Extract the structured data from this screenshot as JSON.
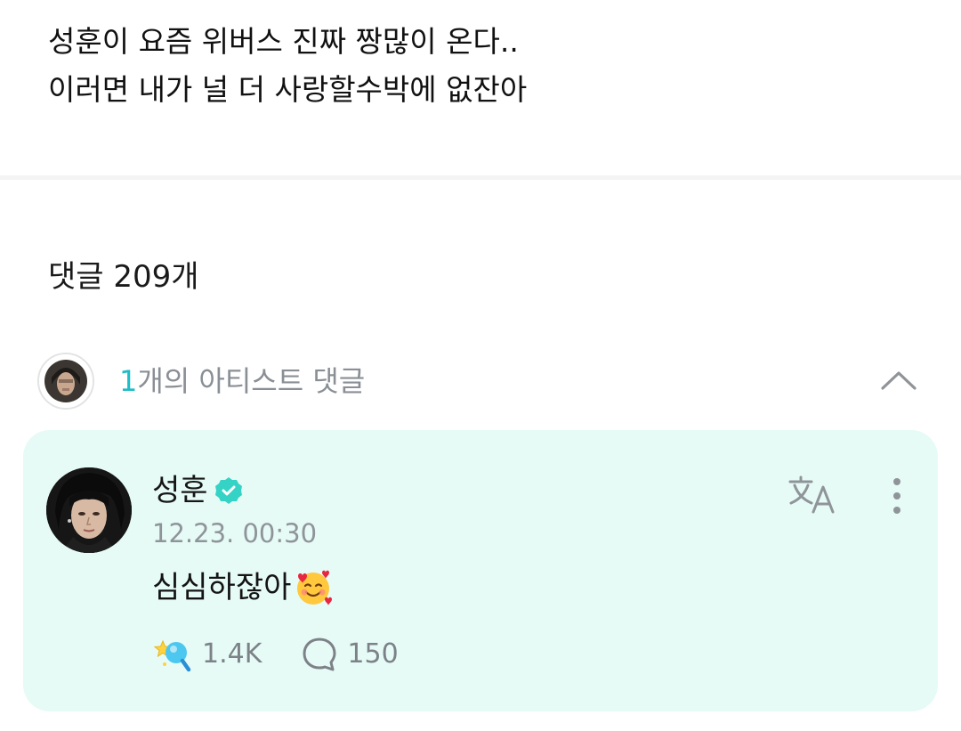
{
  "post": {
    "lines": [
      "성훈이 요즘 위버스 진짜 짱많이 온다..",
      "이러면 내가 널 더 사랑할수박에 없잔아"
    ]
  },
  "comments": {
    "header": "댓글 209개",
    "artist_summary": {
      "count": "1",
      "label": "개의 아티스트 댓글"
    }
  },
  "comment": {
    "author": "성훈",
    "timestamp": "12.23. 00:30",
    "text": "심심하잖아",
    "likes": "1.4K",
    "replies": "150"
  },
  "colors": {
    "accent": "#1fbcc7",
    "card_background": "#e6fbf6",
    "muted_text": "#8a8f96"
  },
  "icons": {
    "verified": "verified-badge-icon",
    "translate": "translate-icon",
    "more": "more-vertical-icon",
    "collapse": "chevron-up-icon",
    "like": "star-wand-icon",
    "reply": "speech-bubble-icon",
    "emoji": "smiling-face-with-hearts-icon"
  }
}
